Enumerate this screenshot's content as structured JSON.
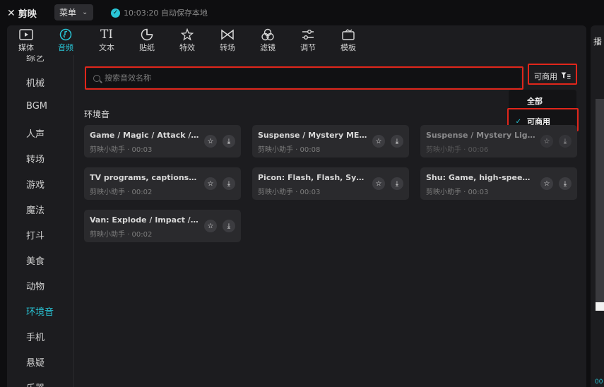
{
  "app": {
    "logo_text": "剪映",
    "menu_label": "菜单",
    "save_status": "10:03:20 自动保存本地"
  },
  "tabs": [
    {
      "label": "媒体",
      "icon": "media-play-icon"
    },
    {
      "label": "音频",
      "icon": "audio-note-icon",
      "active": true
    },
    {
      "label": "文本",
      "icon": "text-icon"
    },
    {
      "label": "贴纸",
      "icon": "sticker-icon"
    },
    {
      "label": "特效",
      "icon": "effects-star-icon"
    },
    {
      "label": "转场",
      "icon": "transition-icon"
    },
    {
      "label": "滤镜",
      "icon": "filter-circles-icon"
    },
    {
      "label": "调节",
      "icon": "adjust-sliders-icon"
    },
    {
      "label": "模板",
      "icon": "template-icon"
    }
  ],
  "sidebar": {
    "items": [
      "综艺",
      "机械",
      "BGM",
      "人声",
      "转场",
      "游戏",
      "魔法",
      "打斗",
      "美食",
      "动物",
      "环境音",
      "手机",
      "悬疑",
      "乐器"
    ],
    "active": "环境音"
  },
  "search": {
    "placeholder": "搜索音效名称",
    "value": ""
  },
  "filter": {
    "label": "可商用",
    "options": [
      {
        "label": "全部",
        "selected": false
      },
      {
        "label": "可商用",
        "selected": true
      }
    ]
  },
  "section_title": "环境音",
  "cards": [
    {
      "name": "Game / Magic / Attack / C...",
      "meta": "剪映小助手 · 00:03"
    },
    {
      "name": "Suspense / Mystery ME Ta...",
      "meta": "剪映小助手 · 00:08"
    },
    {
      "name": "Suspense / Mystery Light ...",
      "meta": "剪映小助手 · 00:06"
    },
    {
      "name": "TV programs, captions, et...",
      "meta": "剪映小助手 · 00:02"
    },
    {
      "name": "Picon: Flash, Flash, Synthe...",
      "meta": "剪映小助手 · 00:03"
    },
    {
      "name": "Shu: Game, high-speed m...",
      "meta": "剪映小助手 · 00:03"
    },
    {
      "name": "Van: Explode / Impact / A...",
      "meta": "剪映小助手 · 00:02"
    }
  ],
  "right_panel": {
    "title": "播",
    "code": "00"
  },
  "colors": {
    "accent": "#29c5d6",
    "highlight": "#e0261b",
    "panel": "#1c1c1f",
    "card": "#2a2a2d"
  }
}
